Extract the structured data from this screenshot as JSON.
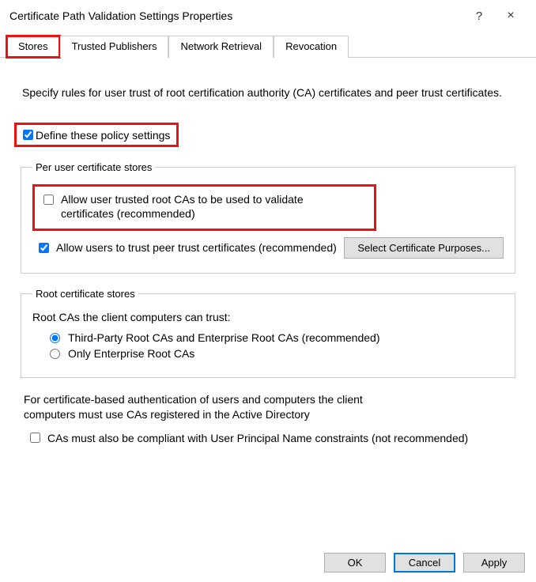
{
  "window": {
    "title": "Certificate Path Validation Settings Properties",
    "help_symbol": "?",
    "close_symbol": "×"
  },
  "tabs": {
    "items": [
      {
        "label": "Stores",
        "active": true
      },
      {
        "label": "Trusted Publishers",
        "active": false
      },
      {
        "label": "Network Retrieval",
        "active": false
      },
      {
        "label": "Revocation",
        "active": false
      }
    ]
  },
  "intro": "Specify rules for user trust of root certification authority (CA) certificates and peer trust certificates.",
  "define": {
    "label": "Define these policy settings",
    "checked": true
  },
  "groups": {
    "peruser": {
      "legend": "Per user certificate stores",
      "allow_root": {
        "label": "Allow user trusted root CAs to be used to validate certificates (recommended)",
        "checked": false
      },
      "allow_peer": {
        "label": "Allow users to trust peer trust certificates (recommended)",
        "checked": true
      },
      "purposes_btn": "Select Certificate Purposes..."
    },
    "rootstores": {
      "legend": "Root certificate stores",
      "desc": "Root CAs the client computers can trust:",
      "radios": {
        "both": {
          "label": "Third-Party Root CAs and Enterprise Root CAs (recommended)",
          "selected": true
        },
        "entonly": {
          "label": "Only Enterprise Root CAs",
          "selected": false
        }
      }
    }
  },
  "footnote": "For certificate-based authentication of users and computers the client computers must use CAs registered in the Active Directory",
  "upn": {
    "label": "CAs must also be compliant with User Principal Name constraints (not recommended)",
    "checked": false
  },
  "buttons": {
    "ok": "OK",
    "cancel": "Cancel",
    "apply": "Apply"
  }
}
